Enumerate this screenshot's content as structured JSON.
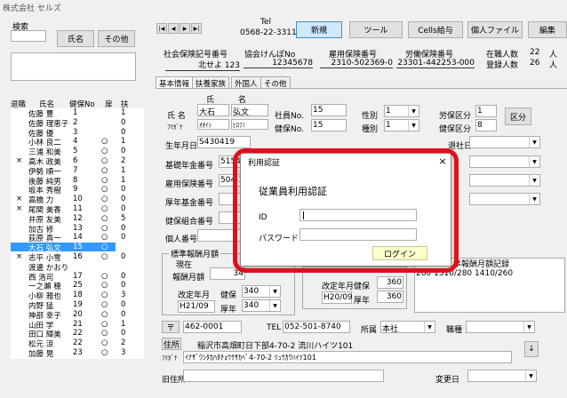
{
  "window": {
    "title": "株式会社 セルズ"
  },
  "left": {
    "search_label": "検索",
    "name_btn": "氏名",
    "other_btn": "その他",
    "headers": [
      "退職",
      "氏名",
      "健保No",
      "扉",
      "扶"
    ],
    "employees": [
      {
        "ret": "",
        "name": "佐藤 豊",
        "no": "1",
        "door": "",
        "fu": "1"
      },
      {
        "ret": "",
        "name": "佐藤 理恵子",
        "no": "2",
        "door": "",
        "fu": "0"
      },
      {
        "ret": "",
        "name": "佐藤 優",
        "no": "3",
        "door": "",
        "fu": "0"
      },
      {
        "ret": "",
        "name": "小林 良二",
        "no": "4",
        "door": "○",
        "fu": "1"
      },
      {
        "ret": "",
        "name": "三浦 和美",
        "no": "5",
        "door": "○",
        "fu": "0"
      },
      {
        "ret": "×",
        "name": "高木 政美",
        "no": "6",
        "door": "○",
        "fu": "2"
      },
      {
        "ret": "",
        "name": "伊勢 順一",
        "no": "7",
        "door": "○",
        "fu": "1"
      },
      {
        "ret": "",
        "name": "後藤 純男",
        "no": "8",
        "door": "○",
        "fu": "1"
      },
      {
        "ret": "",
        "name": "坂本 秀樹",
        "no": "9",
        "door": "○",
        "fu": "0"
      },
      {
        "ret": "×",
        "name": "高橋 力",
        "no": "10",
        "door": "○",
        "fu": "0"
      },
      {
        "ret": "×",
        "name": "尾関 美香",
        "no": "11",
        "door": "○",
        "fu": "0"
      },
      {
        "ret": "",
        "name": "井原 友美",
        "no": "12",
        "door": "○",
        "fu": "5"
      },
      {
        "ret": "",
        "name": "加古 修",
        "no": "13",
        "door": "○",
        "fu": "0"
      },
      {
        "ret": "",
        "name": "荻原 真一",
        "no": "14",
        "door": "○",
        "fu": "0"
      },
      {
        "ret": "",
        "name": "大石 弘文",
        "no": "15",
        "door": "○",
        "fu": "2",
        "sel": true
      },
      {
        "ret": "×",
        "name": "志平 小雪",
        "no": "16",
        "door": "○",
        "fu": "0"
      },
      {
        "ret": "",
        "name": "渡邊 かおり",
        "no": "",
        "door": "",
        "fu": ""
      },
      {
        "ret": "",
        "name": "西 浩司",
        "no": "17",
        "door": "○",
        "fu": "0"
      },
      {
        "ret": "",
        "name": "一之瀬 穂",
        "no": "25",
        "door": "○",
        "fu": "0"
      },
      {
        "ret": "",
        "name": "小柳 雅也",
        "no": "18",
        "door": "○",
        "fu": "3"
      },
      {
        "ret": "",
        "name": "内野 猛",
        "no": "19",
        "door": "○",
        "fu": "0"
      },
      {
        "ret": "",
        "name": "神部 幸子",
        "no": "20",
        "door": "○",
        "fu": "0"
      },
      {
        "ret": "",
        "name": "山田 学",
        "no": "21",
        "door": "○",
        "fu": "1"
      },
      {
        "ret": "",
        "name": "田口 輝美",
        "no": "22",
        "door": "○",
        "fu": "0"
      },
      {
        "ret": "",
        "name": "松元 涼",
        "no": "22",
        "door": "○",
        "fu": "2"
      },
      {
        "ret": "",
        "name": "加藤 晃",
        "no": "23",
        "door": "○",
        "fu": "3"
      }
    ]
  },
  "top": {
    "nav": [
      "|◀",
      "◀",
      "▶",
      "▶|"
    ],
    "tel_label": "Tel",
    "tel": "0568-22-3311",
    "new_btn": "新規",
    "tool_btn": "ツール",
    "cells_btn": "Cells給与",
    "personal_btn": "個人ファイル",
    "edit_btn": "編集",
    "shakai_label": "社会保険記号番号",
    "shakai_val": "北せよ 123",
    "kyokai_label": "協会けんぽNo",
    "kyokai_val": "12345678",
    "koyo_label": "雇用保険番号",
    "koyo_val": "2310-502369-0",
    "rodo_label": "労働保険番号",
    "rodo_val": "23301-442253-000",
    "zaishoku_label": "在職人数",
    "zaishoku_val": "22",
    "zaishoku_unit": "人",
    "toroku_label": "登録人数",
    "toroku_val": "26",
    "toroku_unit": "人"
  },
  "tabs": [
    "基本情報",
    "扶養家族",
    "外国人",
    "その他"
  ],
  "form": {
    "name_label": "氏 名",
    "furi_label": "ﾌﾘｶﾞﾅ",
    "col_shi": "氏",
    "col_mei": "名",
    "sei": "大石",
    "mei": "弘文",
    "sei_kana": "ｵｵｲｼ",
    "mei_kana": "ﾋﾛﾌﾐ",
    "shain_label": "社員No.",
    "shain_val": "15",
    "kenpo_label": "健保No.",
    "kenpo_val": "15",
    "seibetsu_label": "性別",
    "seibetsu_val": "1",
    "shubetsu_label": "種別",
    "shubetsu_val": "1",
    "rodo_kubun_label": "労保区分",
    "rodo_kubun_val": "1",
    "kenpo_kubun_label": "健保区分",
    "kenpo_kubun_val": "8",
    "kubun_btn": "区分",
    "birth_label": "生年月日",
    "birth_val": "S430419",
    "kiso_label": "基礎年金番号",
    "kiso_val": "5154",
    "koyo_label": "雇用保険番号",
    "koyo_val": "504-3",
    "kosei_label": "厚年基金番号",
    "kenko_kumiai_label": "健保組合番号",
    "kojin_label": "個人番号",
    "taishoku_label": "退社日",
    "hyojun_label": "標準報酬月額",
    "genzai_label": "現在",
    "hoshu_label": "報酬月額",
    "hoshu_val": "34",
    "kaitei_label": "改定年月",
    "kenpo2_label": "健保",
    "kenpo2_val": "340",
    "nen1": "H21/09",
    "kosei2_label": "厚年",
    "kosei2_val": "340",
    "kaitei2_label": "改定年月",
    "kenpo3_label": "健保",
    "kenpo3_val": "360",
    "nen2": "H20/09",
    "kosei3_label": "厚年",
    "kosei3_val": "360",
    "kiroku_label": "準報酬月額記録",
    "kiroku_val": "260 1310/280 1410/260",
    "zip_btn": "〒",
    "zip_val": "462-0001",
    "tel_label": "TEL",
    "tel_val": "052-501-8740",
    "shozoku_label": "所属",
    "shozoku_val": "本社",
    "shokushu_label": "職種",
    "addr_btn": "住所",
    "addr_val": "稲沢市高畑町日下部4-70-2 流川ハイツ101",
    "addr_kana_label": "ﾌﾘｶﾞﾅ",
    "addr_kana_val": "ｲﾅｻﾞﾜｼﾀｶﾊﾀﾁｮｳｸｻｶﾍﾞ4-70-2 ﾘｭｳｶﾜﾊｲﾂ101",
    "kyu_label": "旧住所",
    "henko_label": "変更日",
    "down_btn": "↓"
  },
  "dialog": {
    "title": "利用認証",
    "heading": "従業員利用認証",
    "id_label": "ID",
    "id_value": "",
    "pw_label": "パスワード",
    "pw_value": "",
    "login_btn": "ログイン",
    "close": "×"
  }
}
